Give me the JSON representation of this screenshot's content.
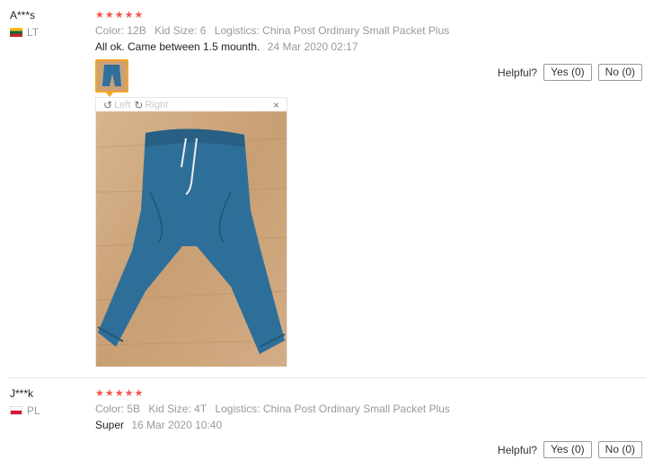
{
  "labels": {
    "color": "Color:",
    "kid_size": "Kid Size:",
    "logistics": "Logistics:",
    "helpful": "Helpful?"
  },
  "reviews": [
    {
      "user": "A***s",
      "country": "LT",
      "rating": 5,
      "color": "12B",
      "kid_size": "6",
      "logistics": "China Post Ordinary Small Packet Plus",
      "text": "All ok. Came between 1.5 mounth.",
      "date": "24 Mar 2020 02:17",
      "yes": "Yes (0)",
      "no": "No (0)"
    },
    {
      "user": "J***k",
      "country": "PL",
      "rating": 5,
      "color": "5B",
      "kid_size": "4T",
      "logistics": "China Post Ordinary Small Packet Plus",
      "text": "Super",
      "date": "16 Mar 2020 10:40",
      "yes": "Yes (0)",
      "no": "No (0)"
    }
  ],
  "viewer": {
    "left": "Left",
    "right": "Right",
    "close": "×"
  },
  "icons": {
    "star": "star-icon",
    "rotate_left": "rotate-left-icon",
    "rotate_right": "rotate-right-icon",
    "close": "close-icon"
  },
  "colors": {
    "star": "#f2554f",
    "thumb_border": "#f5a623",
    "muted_text": "#999999"
  }
}
